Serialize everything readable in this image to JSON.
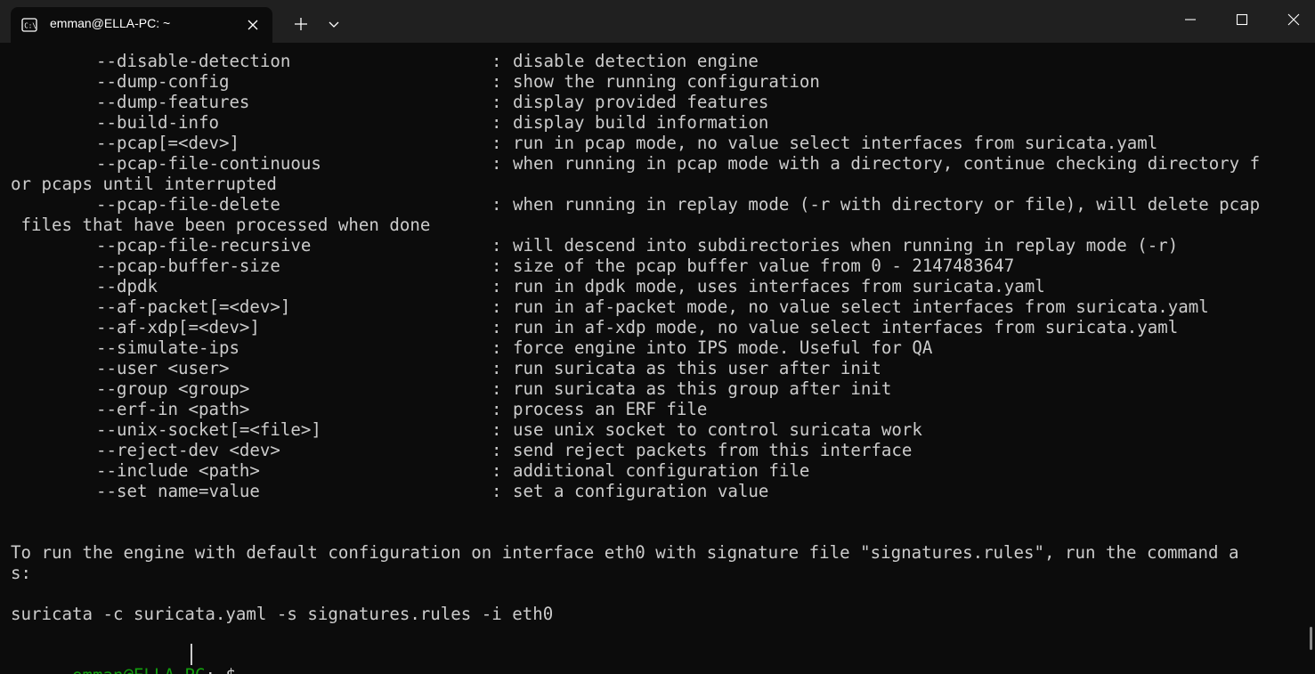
{
  "titlebar": {
    "tab_title": "emman@ELLA-PC: ~",
    "icons": {
      "tab": "terminal-icon",
      "close_tab": "close-icon",
      "new_tab": "plus-icon",
      "dropdown": "chevron-down-icon",
      "minimize": "minimize-icon",
      "maximize": "maximize-icon",
      "close_window": "close-icon"
    }
  },
  "terminal": {
    "options": [
      {
        "option": "--disable-detection",
        "desc": "disable detection engine"
      },
      {
        "option": "--dump-config",
        "desc": "show the running configuration"
      },
      {
        "option": "--dump-features",
        "desc": "display provided features"
      },
      {
        "option": "--build-info",
        "desc": "display build information"
      },
      {
        "option": "--pcap[=<dev>]",
        "desc": "run in pcap mode, no value select interfaces from suricata.yaml"
      },
      {
        "option": "--pcap-file-continuous",
        "desc": "when running in pcap mode with a directory, continue checking directory f",
        "wrap": "or pcaps until interrupted"
      },
      {
        "option": "--pcap-file-delete",
        "desc": "when running in replay mode (-r with directory or file), will delete pcap",
        "wrap": " files that have been processed when done"
      },
      {
        "option": "--pcap-file-recursive",
        "desc": "will descend into subdirectories when running in replay mode (-r)"
      },
      {
        "option": "--pcap-buffer-size",
        "desc": "size of the pcap buffer value from 0 - 2147483647"
      },
      {
        "option": "--dpdk",
        "desc": "run in dpdk mode, uses interfaces from suricata.yaml"
      },
      {
        "option": "--af-packet[=<dev>]",
        "desc": "run in af-packet mode, no value select interfaces from suricata.yaml"
      },
      {
        "option": "--af-xdp[=<dev>]",
        "desc": "run in af-xdp mode, no value select interfaces from suricata.yaml"
      },
      {
        "option": "--simulate-ips",
        "desc": "force engine into IPS mode. Useful for QA"
      },
      {
        "option": "--user <user>",
        "desc": "run suricata as this user after init"
      },
      {
        "option": "--group <group>",
        "desc": "run suricata as this group after init"
      },
      {
        "option": "--erf-in <path>",
        "desc": "process an ERF file"
      },
      {
        "option": "--unix-socket[=<file>]",
        "desc": "use unix socket to control suricata work"
      },
      {
        "option": "--reject-dev <dev>",
        "desc": "send reject packets from this interface"
      },
      {
        "option": "--include <path>",
        "desc": "additional configuration file"
      },
      {
        "option": "--set name=value",
        "desc": "set a configuration value"
      }
    ],
    "separator": ":",
    "usage_line1": "To run the engine with default configuration on interface eth0 with signature file \"signatures.rules\", run the command a",
    "usage_line2": "s:",
    "example_command": "suricata -c suricata.yaml -s signatures.rules -i eth0",
    "prompt": {
      "user_host": "emman@ELLA-PC",
      "colon": ":",
      "path": "~",
      "symbol": "$"
    }
  },
  "colors": {
    "background": "#0c0c0c",
    "titlebar": "#202020",
    "text": "#cccccc",
    "prompt_user": "#13a10e",
    "prompt_path": "#3b78ff"
  }
}
